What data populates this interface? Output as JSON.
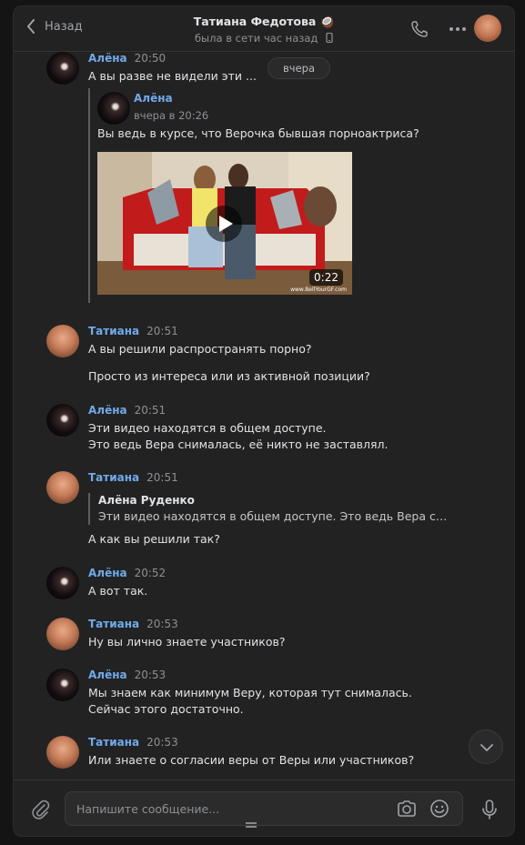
{
  "header": {
    "back_label": "Назад",
    "title": "Татиана Федотова 🥥",
    "status": "была в сети час назад"
  },
  "date_separator": "вчера",
  "messages": [
    {
      "author": "Алёна",
      "time": "20:50",
      "lines": [
        "А вы разве не видели эти ..."
      ],
      "forwarded": {
        "author": "Алёна",
        "date": "вчера в 20:26",
        "text": "Вы ведь в курсе, что Верочка бывшая порноактриса?",
        "video_duration": "0:22",
        "video_watermark": "www.BellYourGF.com"
      }
    },
    {
      "author": "Татиана",
      "time": "20:51",
      "lines": [
        "А вы решили распространять порно?",
        "Просто из интереса или из активной позиции?"
      ]
    },
    {
      "author": "Алёна",
      "time": "20:51",
      "lines": [
        "Эти видео находятся в общем доступе.",
        "Это ведь Вера снималась, её никто не заставлял."
      ]
    },
    {
      "author": "Татиана",
      "time": "20:51",
      "quote": {
        "author": "Алёна Руденко",
        "text": "Эти видео находятся в общем доступе. Это ведь Вера сним…"
      },
      "lines": [
        "А как вы решили так?"
      ]
    },
    {
      "author": "Алёна",
      "time": "20:52",
      "lines": [
        "А вот так."
      ]
    },
    {
      "author": "Татиана",
      "time": "20:53",
      "lines": [
        "Ну вы лично знаете участников?"
      ]
    },
    {
      "author": "Алёна",
      "time": "20:53",
      "lines": [
        "Мы знаем как минимум Веру, которая тут снималась.",
        "Сейчас этого достаточно."
      ]
    },
    {
      "author": "Татиана",
      "time": "20:53",
      "lines": [
        "Или знаете о согласии веры от Веры или участников?"
      ]
    }
  ],
  "composer": {
    "placeholder": "Напишите сообщение..."
  },
  "colors": {
    "background": "#222222",
    "accent_author": "#71aaeb",
    "text": "#e1e3e6",
    "muted": "#8d9094"
  }
}
